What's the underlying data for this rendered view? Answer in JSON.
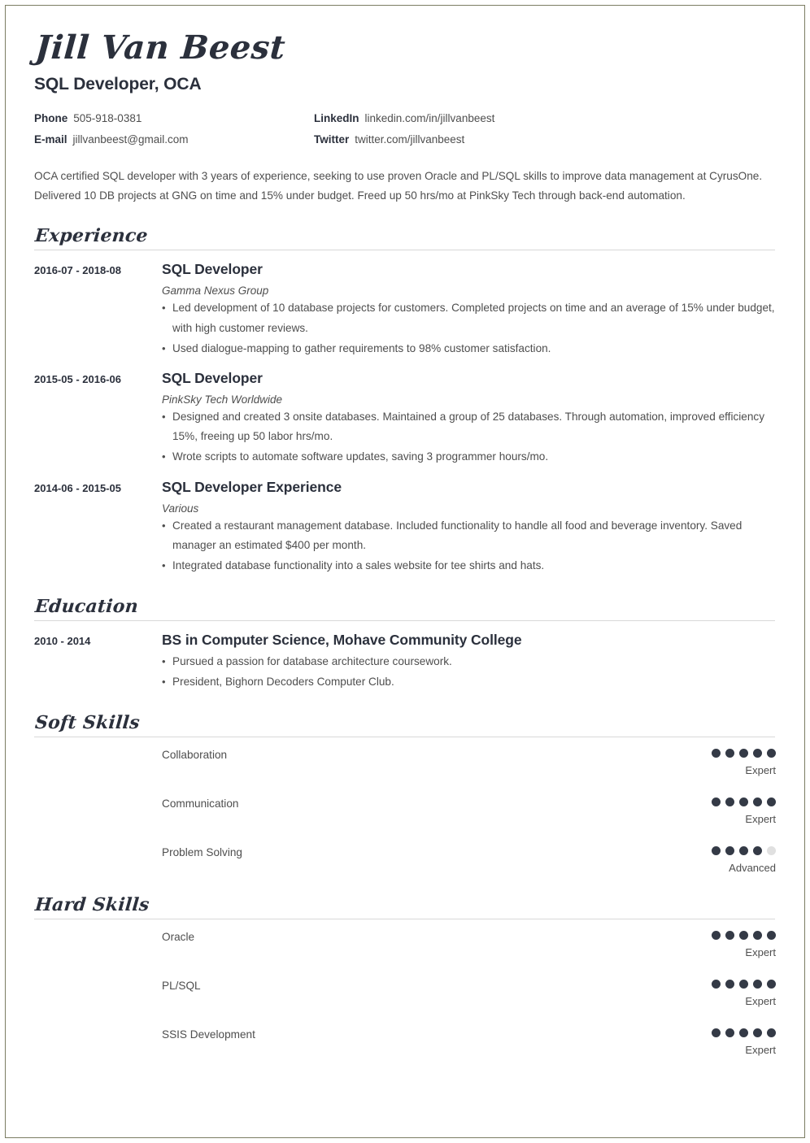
{
  "header": {
    "name": "Jill Van Beest",
    "job_title": "SQL Developer, OCA",
    "contacts": [
      {
        "label": "Phone",
        "value": "505-918-0381"
      },
      {
        "label": "LinkedIn",
        "value": "linkedin.com/in/jillvanbeest"
      },
      {
        "label": "E-mail",
        "value": "jillvanbeest@gmail.com"
      },
      {
        "label": "Twitter",
        "value": "twitter.com/jillvanbeest"
      }
    ]
  },
  "summary": "OCA certified SQL developer with 3 years of experience, seeking to use proven Oracle and PL/SQL skills to improve data management at CyrusOne. Delivered 10 DB projects at GNG on time and 15% under budget. Freed up 50 hrs/mo at PinkSky Tech through back-end automation.",
  "sections": {
    "experience": {
      "heading": "Experience",
      "entries": [
        {
          "date": "2016-07 - 2018-08",
          "title": "SQL Developer",
          "org": "Gamma Nexus Group",
          "bullets": [
            "Led development of 10 database projects for customers. Completed projects on time and an average of 15% under budget, with high customer reviews.",
            "Used dialogue-mapping to gather requirements to 98% customer satisfaction."
          ]
        },
        {
          "date": "2015-05 - 2016-06",
          "title": "SQL Developer",
          "org": "PinkSky Tech Worldwide",
          "bullets": [
            "Designed and created 3 onsite databases. Maintained a group of 25 databases. Through automation, improved efficiency 15%, freeing up 50 labor hrs/mo.",
            "Wrote scripts to automate software updates, saving 3 programmer hours/mo."
          ]
        },
        {
          "date": "2014-06 - 2015-05",
          "title": "SQL Developer Experience",
          "org": "Various",
          "bullets": [
            "Created a restaurant management database. Included functionality to handle all food and beverage inventory. Saved manager an estimated $400 per month.",
            "Integrated database functionality into a sales website for tee shirts and hats."
          ]
        }
      ]
    },
    "education": {
      "heading": "Education",
      "entries": [
        {
          "date": "2010 - 2014",
          "title": "BS in Computer Science, Mohave Community College",
          "org": "",
          "bullets": [
            "Pursued a passion for database architecture coursework.",
            "President, Bighorn Decoders Computer Club."
          ]
        }
      ]
    },
    "soft_skills": {
      "heading": "Soft Skills",
      "max_rating": 5,
      "items": [
        {
          "name": "Collaboration",
          "rating": 5,
          "level": "Expert"
        },
        {
          "name": "Communication",
          "rating": 5,
          "level": "Expert"
        },
        {
          "name": "Problem Solving",
          "rating": 4,
          "level": "Advanced"
        }
      ]
    },
    "hard_skills": {
      "heading": "Hard Skills",
      "max_rating": 5,
      "items": [
        {
          "name": "Oracle",
          "rating": 5,
          "level": "Expert"
        },
        {
          "name": "PL/SQL",
          "rating": 5,
          "level": "Expert"
        },
        {
          "name": "SSIS Development",
          "rating": 5,
          "level": "Expert"
        }
      ]
    }
  },
  "colors": {
    "ink": "#2b303c",
    "body_text": "#4e4e4e",
    "dot_filled": "#343a46",
    "dot_empty": "#e0e0e0",
    "rule": "#d8d8d8",
    "frame": "#7c7d63"
  }
}
